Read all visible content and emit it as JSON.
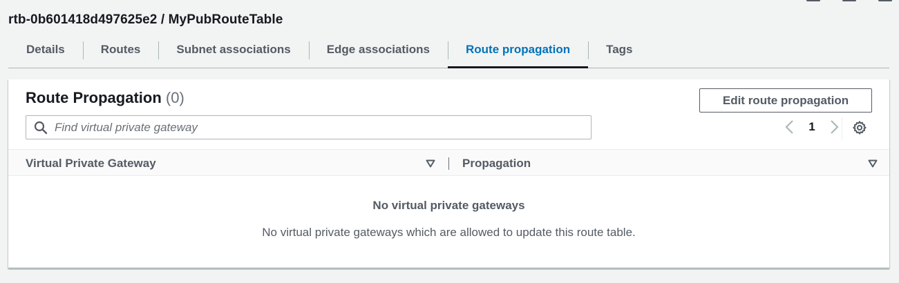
{
  "page": {
    "title": "rtb-0b601418d497625e2 / MyPubRouteTable"
  },
  "tabs": [
    {
      "label": "Details",
      "active": false
    },
    {
      "label": "Routes",
      "active": false
    },
    {
      "label": "Subnet associations",
      "active": false
    },
    {
      "label": "Edge associations",
      "active": false
    },
    {
      "label": "Route propagation",
      "active": true
    },
    {
      "label": "Tags",
      "active": false
    }
  ],
  "panel": {
    "title": "Route Propagation",
    "count": "(0)",
    "edit_button": "Edit route propagation",
    "search_placeholder": "Find virtual private gateway",
    "search_value": "",
    "current_page": "1",
    "columns": [
      "Virtual Private Gateway",
      "Propagation"
    ],
    "empty_title": "No virtual private gateways",
    "empty_description": "No virtual private gateways which are allowed to update this route table."
  },
  "colors": {
    "accent": "#0073bb",
    "text_dark": "#16191f",
    "text_muted": "#545b64",
    "background": "#f2f3f3"
  },
  "icons": {
    "search": "search-icon",
    "prev": "chevron-left-icon",
    "next": "chevron-right-icon",
    "settings": "gear-icon",
    "sort": "sort-caret-down-icon"
  }
}
